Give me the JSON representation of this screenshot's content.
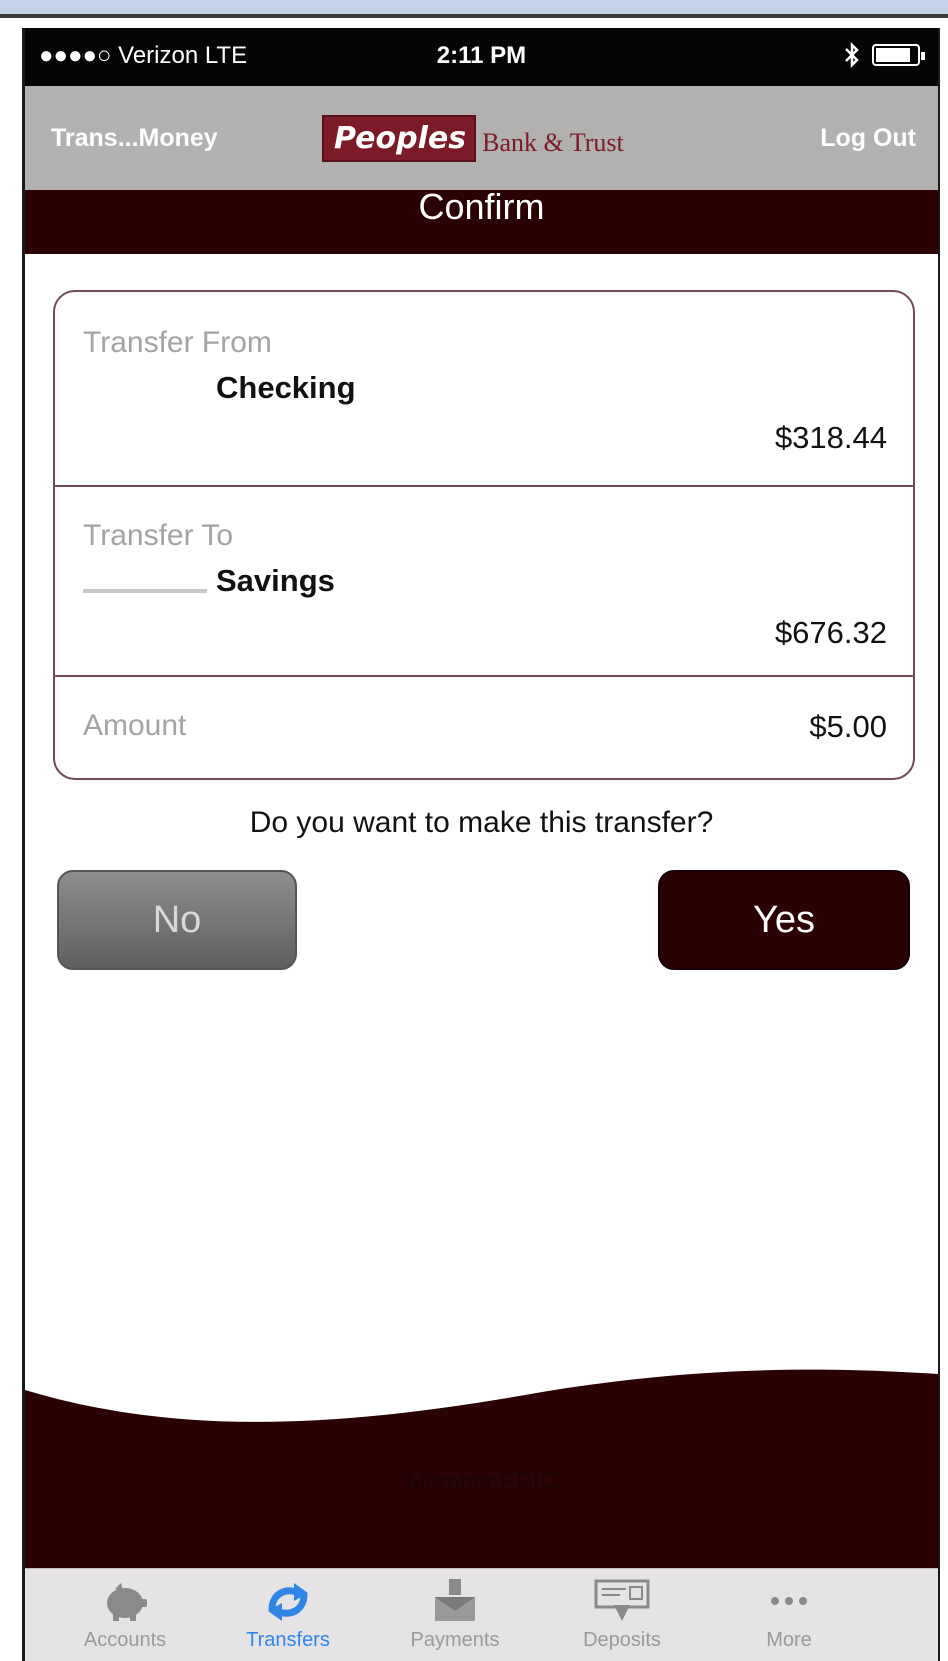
{
  "status_bar": {
    "carrier": "●●●●○ Verizon  LTE",
    "time": "2:11 PM"
  },
  "nav": {
    "back_label": "Trans...Money",
    "logo_main": "Peoples",
    "logo_sub": "Bank & Trust",
    "logout_label": "Log Out"
  },
  "page": {
    "title": "Confirm"
  },
  "transfer": {
    "from_label": "Transfer From",
    "from_account": "Checking",
    "from_balance": "$318.44",
    "to_label": "Transfer To",
    "to_account": "Savings",
    "to_balance": "$676.32",
    "amount_label": "Amount",
    "amount_value": "$5.00"
  },
  "prompt": {
    "question": "Do you want to make this transfer?",
    "no_label": "No",
    "yes_label": "Yes"
  },
  "footer": {
    "fdic": "Member FDIC"
  },
  "tabs": [
    {
      "label": "Accounts",
      "icon": "piggy-bank-icon"
    },
    {
      "label": "Transfers",
      "icon": "transfer-arrows-icon"
    },
    {
      "label": "Payments",
      "icon": "envelope-icon"
    },
    {
      "label": "Deposits",
      "icon": "check-deposit-icon"
    },
    {
      "label": "More",
      "icon": "more-dots-icon"
    }
  ],
  "colors": {
    "brand": "#7a1b27",
    "dark_maroon": "#2b0204",
    "active_tab": "#2f86e6"
  }
}
